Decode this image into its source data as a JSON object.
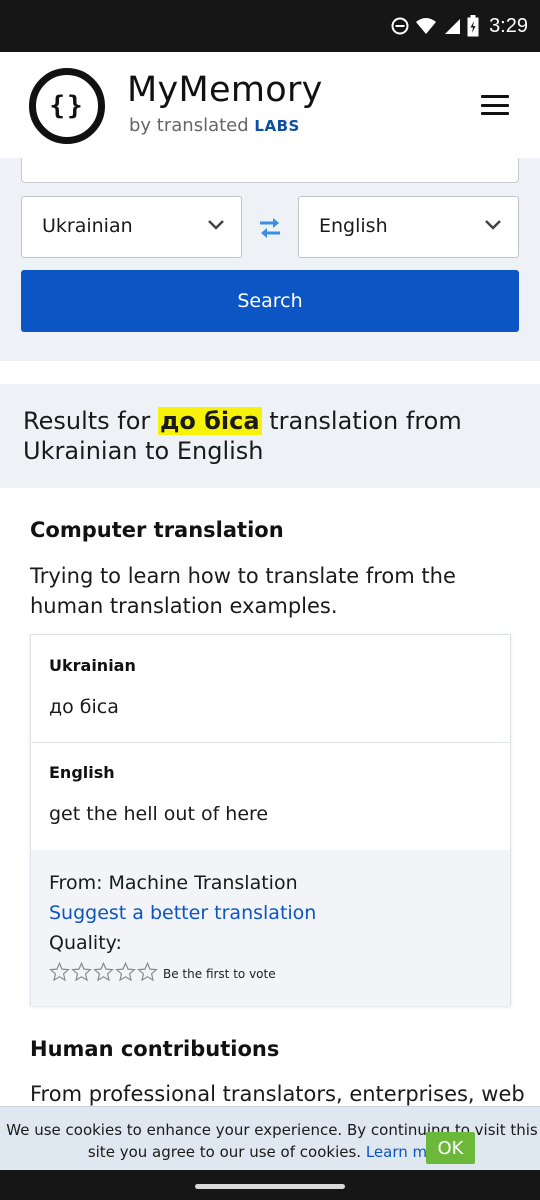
{
  "status_bar": {
    "time": "3:29"
  },
  "header": {
    "logo_text": "{}",
    "brand_title": "MyMemory",
    "brand_sub_prefix": "by translated",
    "brand_sub_suffix": "LABS"
  },
  "search": {
    "input_value": "",
    "source_lang": "Ukrainian",
    "target_lang": "English",
    "button_label": "Search"
  },
  "results_header": {
    "prefix": "Results for",
    "query": "до біса",
    "suffix": "translation from Ukrainian to English"
  },
  "computer_translation": {
    "title": "Computer translation",
    "description": "Trying to learn how to translate from the human translation examples.",
    "source_lang": "Ukrainian",
    "source_text": "до біса",
    "target_lang": "English",
    "target_text": "get the hell out of here",
    "from_label": "From: Machine Translation",
    "suggest_link": "Suggest a better translation",
    "quality_label": "Quality:",
    "vote_text": "Be the first to vote",
    "rating": 0,
    "rating_max": 5
  },
  "human_contributions": {
    "title": "Human contributions",
    "description": "From professional translators, enterprises, web"
  },
  "cookie_banner": {
    "text": "We use cookies to enhance your experience. By continuing to visit this site you agree to our use of cookies.",
    "link": "Learn more.",
    "ok_label": "OK"
  },
  "colors": {
    "accent_blue": "#0b55c5",
    "highlight_yellow": "#f7f20a",
    "ok_green": "#6bb83a"
  }
}
